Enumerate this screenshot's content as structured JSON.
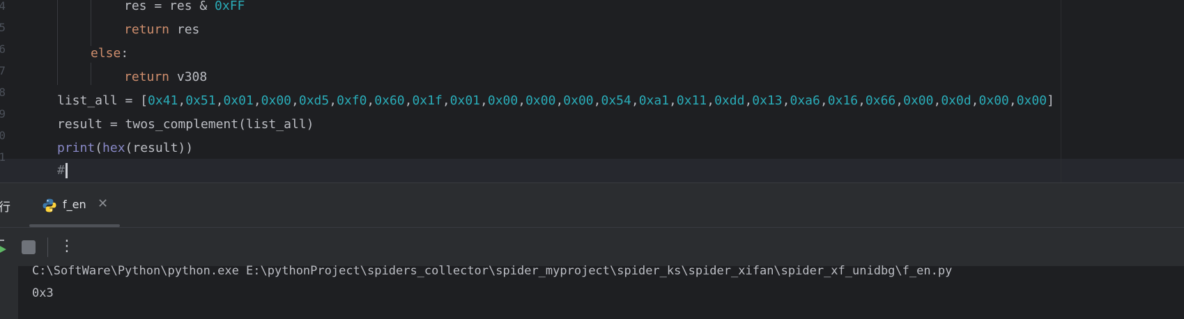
{
  "editor": {
    "line_numbers": [
      "4",
      "5",
      "6",
      "7",
      "8",
      "9",
      "0",
      "1"
    ],
    "lines": [
      {
        "tokens": [
          {
            "t": "res = res & ",
            "c": ""
          },
          {
            "t": "0xFF",
            "c": "num"
          }
        ]
      },
      {
        "tokens": [
          {
            "t": "return",
            "c": "kw"
          },
          {
            "t": " res",
            "c": ""
          }
        ]
      },
      {
        "tokens": [
          {
            "t": "else",
            "c": "kw"
          },
          {
            "t": ":",
            "c": ""
          }
        ]
      },
      {
        "tokens": [
          {
            "t": "return",
            "c": "kw"
          },
          {
            "t": " v308",
            "c": ""
          }
        ]
      },
      {
        "tokens": [
          {
            "t": "list_all = [",
            "c": ""
          },
          {
            "t": "0x41",
            "c": "num"
          },
          {
            "t": ",",
            "c": ""
          },
          {
            "t": "0x51",
            "c": "num"
          },
          {
            "t": ",",
            "c": ""
          },
          {
            "t": "0x01",
            "c": "num"
          },
          {
            "t": ",",
            "c": ""
          },
          {
            "t": "0x00",
            "c": "num"
          },
          {
            "t": ",",
            "c": ""
          },
          {
            "t": "0xd5",
            "c": "num"
          },
          {
            "t": ",",
            "c": ""
          },
          {
            "t": "0xf0",
            "c": "num"
          },
          {
            "t": ",",
            "c": ""
          },
          {
            "t": "0x60",
            "c": "num"
          },
          {
            "t": ",",
            "c": ""
          },
          {
            "t": "0x1f",
            "c": "num"
          },
          {
            "t": ",",
            "c": ""
          },
          {
            "t": "0x01",
            "c": "num"
          },
          {
            "t": ",",
            "c": ""
          },
          {
            "t": "0x00",
            "c": "num"
          },
          {
            "t": ",",
            "c": ""
          },
          {
            "t": "0x00",
            "c": "num"
          },
          {
            "t": ",",
            "c": ""
          },
          {
            "t": "0x00",
            "c": "num"
          },
          {
            "t": ",",
            "c": ""
          },
          {
            "t": "0x54",
            "c": "num"
          },
          {
            "t": ",",
            "c": ""
          },
          {
            "t": "0xa1",
            "c": "num"
          },
          {
            "t": ",",
            "c": ""
          },
          {
            "t": "0x11",
            "c": "num"
          },
          {
            "t": ",",
            "c": ""
          },
          {
            "t": "0xdd",
            "c": "num"
          },
          {
            "t": ",",
            "c": ""
          },
          {
            "t": "0x13",
            "c": "num"
          },
          {
            "t": ",",
            "c": ""
          },
          {
            "t": "0xa6",
            "c": "num"
          },
          {
            "t": ",",
            "c": ""
          },
          {
            "t": "0x16",
            "c": "num"
          },
          {
            "t": ",",
            "c": ""
          },
          {
            "t": "0x66",
            "c": "num"
          },
          {
            "t": ",",
            "c": ""
          },
          {
            "t": "0x00",
            "c": "num"
          },
          {
            "t": ",",
            "c": ""
          },
          {
            "t": "0x0d",
            "c": "num"
          },
          {
            "t": ",",
            "c": ""
          },
          {
            "t": "0x00",
            "c": "num"
          },
          {
            "t": ",",
            "c": ""
          },
          {
            "t": "0x00",
            "c": "num"
          },
          {
            "t": "]",
            "c": ""
          }
        ]
      },
      {
        "tokens": [
          {
            "t": "result = twos_complement(list_all)",
            "c": ""
          }
        ]
      },
      {
        "tokens": [
          {
            "t": "print",
            "c": "bi"
          },
          {
            "t": "(",
            "c": ""
          },
          {
            "t": "hex",
            "c": "bi"
          },
          {
            "t": "(result))",
            "c": ""
          }
        ]
      },
      {
        "tokens": [
          {
            "t": "#",
            "c": "cm"
          }
        ]
      }
    ]
  },
  "run_panel": {
    "title": "行",
    "tab_label": "f_en",
    "tab_close": "✕",
    "more_label": "⋮",
    "console": {
      "command": "C:\\SoftWare\\Python\\python.exe E:\\pythonProject\\spiders_collector\\spider_myproject\\spider_ks\\spider_xifan\\spider_xf_unidbg\\f_en.py",
      "output": "0x3"
    }
  },
  "colors": {
    "background": "#1e1f22",
    "panel": "#2b2d30",
    "keyword": "#cf8e6d",
    "number": "#2aacb8",
    "builtin": "#8888c6",
    "text": "#bcbec4",
    "python_blue": "#3c78aa",
    "python_yellow": "#ffd43b"
  }
}
